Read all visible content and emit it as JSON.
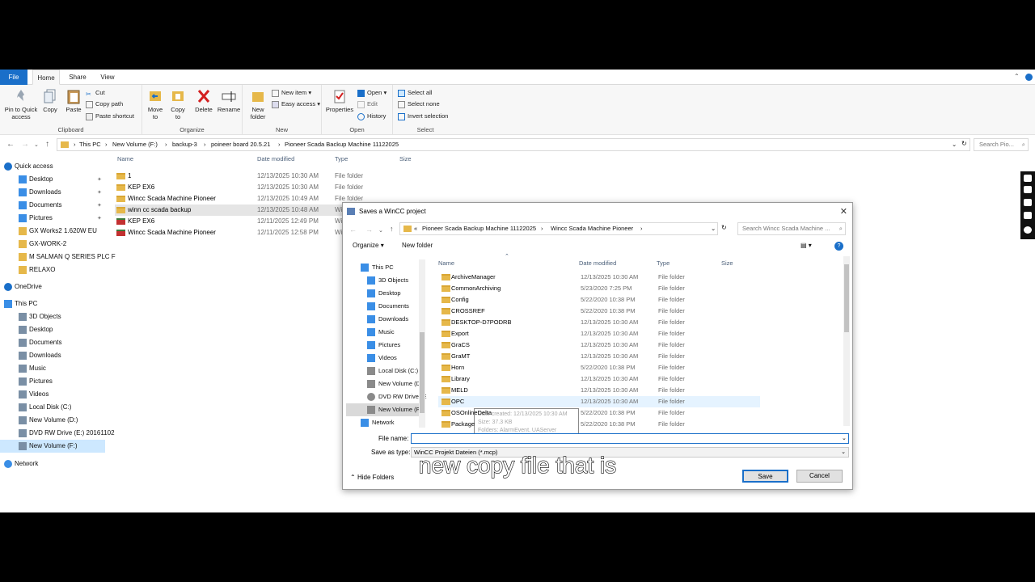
{
  "ribbon_tabs": [
    "File",
    "Home",
    "Share",
    "View"
  ],
  "ribbon": {
    "clipboard": {
      "label": "Clipboard",
      "pin": "Pin to Quick access",
      "copy": "Copy",
      "paste": "Paste",
      "cut": "Cut",
      "copy_path": "Copy path",
      "paste_shortcut": "Paste shortcut"
    },
    "organize": {
      "label": "Organize",
      "move_to": "Move to",
      "copy_to": "Copy to",
      "delete": "Delete",
      "rename": "Rename"
    },
    "new": {
      "label": "New",
      "new_folder": "New folder",
      "new_item": "New item",
      "easy_access": "Easy access"
    },
    "open": {
      "label": "Open",
      "properties": "Properties",
      "open": "Open",
      "edit": "Edit",
      "history": "History"
    },
    "select": {
      "label": "Select",
      "select_all": "Select all",
      "select_none": "Select none",
      "invert": "Invert selection"
    }
  },
  "address": {
    "crumbs": [
      "This PC",
      "New Volume (F:)",
      "backup-3",
      "poineer board 20.5.21",
      "Pioneer Scada Backup Machine 11122025"
    ],
    "search_placeholder": "Search Pio..."
  },
  "nav": {
    "quick_access": "Quick access",
    "quick_items": [
      "Desktop",
      "Downloads",
      "Documents",
      "Pictures",
      "GX Works2 1.620W EU",
      "GX-WORK-2",
      "M SALMAN Q SERIES PLC F",
      "RELAXO"
    ],
    "onedrive": "OneDrive",
    "this_pc": "This PC",
    "pc_items": [
      "3D Objects",
      "Desktop",
      "Documents",
      "Downloads",
      "Music",
      "Pictures",
      "Videos",
      "Local Disk (C:)",
      "New Volume (D:)",
      "DVD RW Drive (E:) 20161102",
      "New Volume (F:)"
    ],
    "network": "Network"
  },
  "columns": {
    "name": "Name",
    "date": "Date modified",
    "type": "Type",
    "size": "Size"
  },
  "files": [
    {
      "name": "1",
      "date": "12/13/2025 10:30 AM",
      "type": "File folder"
    },
    {
      "name": "KEP EX6",
      "date": "12/13/2025 10:30 AM",
      "type": "File folder"
    },
    {
      "name": "Wincc Scada Machine Pioneer",
      "date": "12/13/2025 10:49 AM",
      "type": "File folder"
    },
    {
      "name": "winn cc scada backup",
      "date": "12/13/2025 10:48 AM",
      "type": "Wi"
    },
    {
      "name": "KEP EX6",
      "date": "12/11/2025 12:49 PM",
      "type": "Wi"
    },
    {
      "name": "Wincc Scada Machine Pioneer",
      "date": "12/11/2025 12:58 PM",
      "type": "Wi"
    }
  ],
  "dialog": {
    "title": "Saves a WinCC project",
    "crumbs": [
      "Pioneer Scada Backup Machine 11122025",
      "Wincc Scada Machine Pioneer"
    ],
    "search_placeholder": "Search Wincc Scada Machine ...",
    "organize": "Organize",
    "new_folder": "New folder",
    "nav": [
      "This PC",
      "3D Objects",
      "Desktop",
      "Documents",
      "Downloads",
      "Music",
      "Pictures",
      "Videos",
      "Local Disk (C:)",
      "New Volume (D:)",
      "DVD RW Drive (E:)",
      "New Volume (F:)",
      "Network"
    ],
    "columns": {
      "name": "Name",
      "date": "Date modified",
      "type": "Type",
      "size": "Size"
    },
    "rows": [
      {
        "name": "ArchiveManager",
        "date": "12/13/2025 10:30 AM",
        "type": "File folder"
      },
      {
        "name": "CommonArchiving",
        "date": "5/23/2020 7:25 PM",
        "type": "File folder"
      },
      {
        "name": "Config",
        "date": "5/22/2020 10:38 PM",
        "type": "File folder"
      },
      {
        "name": "CROSSREF",
        "date": "5/22/2020 10:38 PM",
        "type": "File folder"
      },
      {
        "name": "DESKTOP-D7PODRB",
        "date": "12/13/2025 10:30 AM",
        "type": "File folder"
      },
      {
        "name": "Export",
        "date": "12/13/2025 10:30 AM",
        "type": "File folder"
      },
      {
        "name": "GraCS",
        "date": "12/13/2025 10:30 AM",
        "type": "File folder"
      },
      {
        "name": "GraMT",
        "date": "12/13/2025 10:30 AM",
        "type": "File folder"
      },
      {
        "name": "Horn",
        "date": "5/22/2020 10:38 PM",
        "type": "File folder"
      },
      {
        "name": "Library",
        "date": "12/13/2025 10:30 AM",
        "type": "File folder"
      },
      {
        "name": "MELD",
        "date": "12/13/2025 10:30 AM",
        "type": "File folder"
      },
      {
        "name": "OPC",
        "date": "12/13/2025 10:30 AM",
        "type": "File folder"
      },
      {
        "name": "OSOnlineDelta",
        "date": "5/22/2020 10:38 PM",
        "type": "File folder"
      },
      {
        "name": "Package",
        "date": "5/22/2020 10:38 PM",
        "type": "File folder"
      }
    ],
    "tooltip": {
      "created": "Date created: 12/13/2025 10:30 AM",
      "size": "Size: 37.3 KB",
      "folders": "Folders: AlarmEvent, UAServer"
    },
    "file_name_label": "File name:",
    "file_name_value": "",
    "save_type_label": "Save as type:",
    "save_type_value": "WinCC Projekt Dateien (*.mcp)",
    "hide_folders": "Hide Folders",
    "save": "Save",
    "cancel": "Cancel"
  },
  "caption": "new copy file that is",
  "colors": {
    "accent": "#1a6fc9",
    "selection": "#cde8ff",
    "folder": "#e6b84a"
  }
}
